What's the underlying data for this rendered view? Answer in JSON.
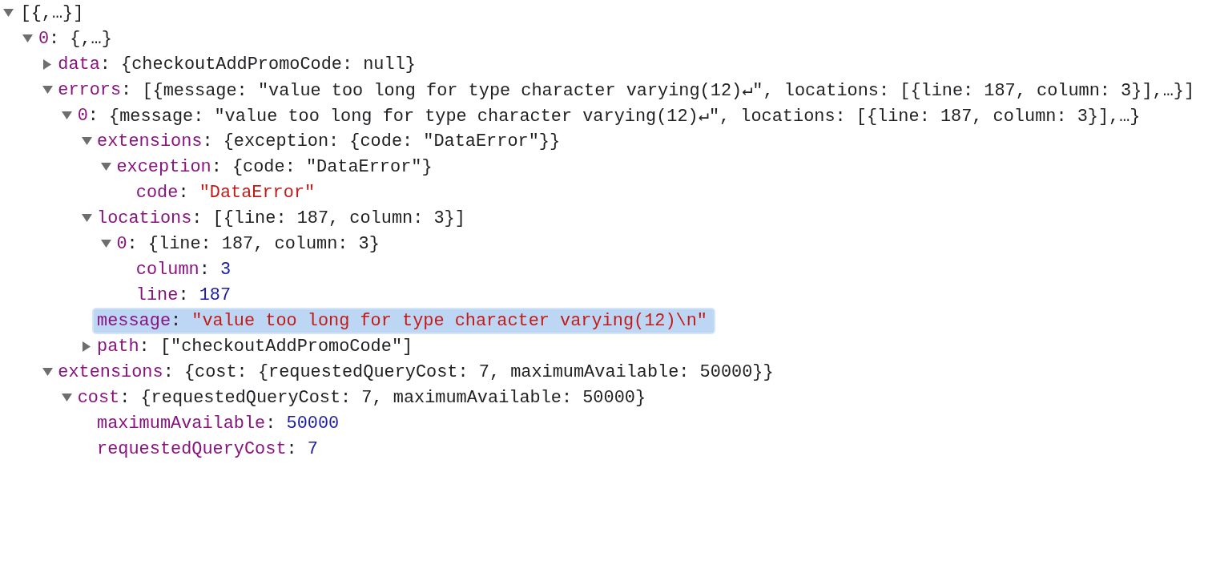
{
  "separator": ":",
  "tree": {
    "kind": "object",
    "preview": "[{,…}]",
    "expanded": true,
    "selected": false,
    "children": [
      {
        "key": "0",
        "kind": "object",
        "preview": "{,…}",
        "expanded": true,
        "selected": false,
        "children": [
          {
            "key": "data",
            "kind": "object",
            "preview": "{checkoutAddPromoCode: null}",
            "expanded": false,
            "selected": false
          },
          {
            "key": "errors",
            "kind": "object",
            "preview": "[{message: \"value too long for type character varying(12)↵\", locations: [{line: 187, column: 3}],…}]",
            "expanded": true,
            "selected": false,
            "children": [
              {
                "key": "0",
                "kind": "object",
                "preview": "{message: \"value too long for type character varying(12)↵\", locations: [{line: 187, column: 3}],…}",
                "expanded": true,
                "selected": false,
                "children": [
                  {
                    "key": "extensions",
                    "kind": "object",
                    "preview": "{exception: {code: \"DataError\"}}",
                    "expanded": true,
                    "selected": false,
                    "children": [
                      {
                        "key": "exception",
                        "kind": "object",
                        "preview": "{code: \"DataError\"}",
                        "expanded": true,
                        "selected": false,
                        "children": [
                          {
                            "key": "code",
                            "kind": "string",
                            "value": "\"DataError\"",
                            "selected": false
                          }
                        ]
                      }
                    ]
                  },
                  {
                    "key": "locations",
                    "kind": "object",
                    "preview": "[{line: 187, column: 3}]",
                    "expanded": true,
                    "selected": false,
                    "children": [
                      {
                        "key": "0",
                        "kind": "object",
                        "preview": "{line: 187, column: 3}",
                        "expanded": true,
                        "selected": false,
                        "children": [
                          {
                            "key": "column",
                            "kind": "number",
                            "value": "3",
                            "selected": false
                          },
                          {
                            "key": "line",
                            "kind": "number",
                            "value": "187",
                            "selected": false
                          }
                        ]
                      }
                    ]
                  },
                  {
                    "key": "message",
                    "kind": "string",
                    "value": "\"value too long for type character varying(12)\\n\"",
                    "selected": true
                  },
                  {
                    "key": "path",
                    "kind": "object",
                    "preview": "[\"checkoutAddPromoCode\"]",
                    "expanded": false,
                    "selected": false
                  }
                ]
              }
            ]
          },
          {
            "key": "extensions",
            "kind": "object",
            "preview": "{cost: {requestedQueryCost: 7, maximumAvailable: 50000}}",
            "expanded": true,
            "selected": false,
            "children": [
              {
                "key": "cost",
                "kind": "object",
                "preview": "{requestedQueryCost: 7, maximumAvailable: 50000}",
                "expanded": true,
                "selected": false,
                "children": [
                  {
                    "key": "maximumAvailable",
                    "kind": "number",
                    "value": "50000",
                    "selected": false
                  },
                  {
                    "key": "requestedQueryCost",
                    "kind": "number",
                    "value": "7",
                    "selected": false
                  }
                ]
              }
            ]
          }
        ]
      }
    ]
  }
}
